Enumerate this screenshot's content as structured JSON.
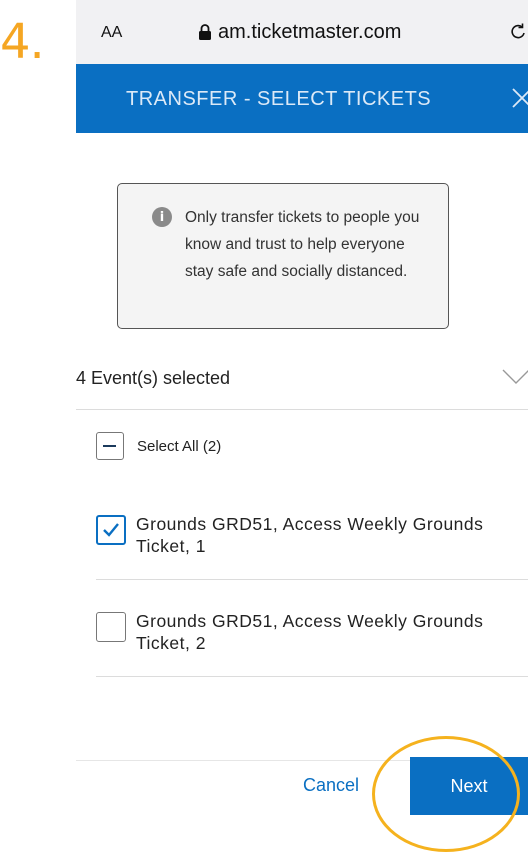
{
  "annotation": {
    "step_label": "4."
  },
  "browser": {
    "text_size_label": "AA",
    "url": "am.ticketmaster.com",
    "icons": {
      "lock": "lock-icon",
      "reload": "reload-icon"
    }
  },
  "header": {
    "title": "TRANSFER - SELECT TICKETS",
    "close_icon": "close-icon",
    "background": "#0a6fc2"
  },
  "info_box": {
    "icon": "info-icon",
    "icon_glyph": "i",
    "message": "Only transfer tickets to people you know and trust to help everyone stay safe and socially distanced."
  },
  "events": {
    "selected_label": "4 Event(s) selected",
    "chevron_icon": "chevron-down-icon"
  },
  "select_all": {
    "label": "Select All (2)",
    "state": "indeterminate"
  },
  "tickets": [
    {
      "label": "Grounds GRD51, Access Weekly Grounds Ticket, 1",
      "checked": true
    },
    {
      "label": "Grounds GRD51, Access Weekly Grounds Ticket, 2",
      "checked": false
    }
  ],
  "footer": {
    "cancel_label": "Cancel",
    "next_label": "Next"
  },
  "colors": {
    "accent": "#0a6fc2",
    "annotation": "#f5a623"
  }
}
